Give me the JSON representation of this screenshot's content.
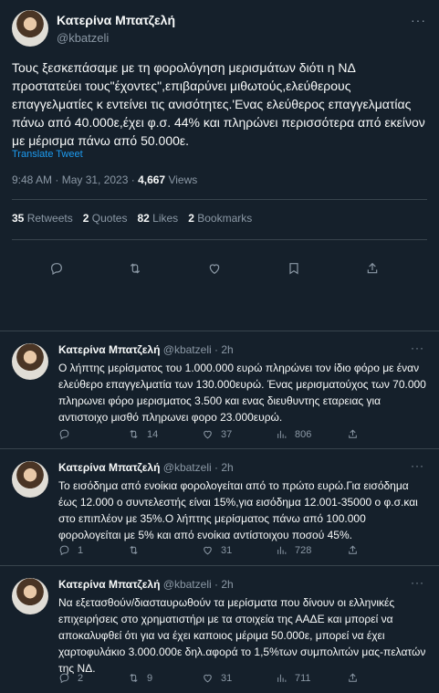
{
  "main_tweet": {
    "author_name": "Κατερίνα Μπατζελή",
    "author_handle": "@kbatzeli",
    "text": "Τους ξεσκεπάσαμε με τη φορολόγηση μερισμάτων διότι  η ΝΔ προστατεύει τους\"έχοντες\",επιβαρύνει μιθωτούς,ελεύθερους επαγγελματίες κ εντείνει τις ανισότητες.'Ενας ελεύθερος επαγγελματίας πάνω από 40.000ε,έχει φ.σ. 44% και πληρώνει περισσότερα από εκείνον με μέρισμα πάνω από 50.000ε.",
    "translate_label": "Translate Tweet",
    "timestamp": "9:48 AM · May 31, 2023 · ",
    "views_count": "4,667",
    "views_label": " Views",
    "stats": {
      "retweets_count": "35",
      "retweets_label": "Retweets",
      "quotes_count": "2",
      "quotes_label": "Quotes",
      "likes_count": "82",
      "likes_label": "Likes",
      "bookmarks_count": "2",
      "bookmarks_label": "Bookmarks"
    }
  },
  "replies": [
    {
      "author_name": "Κατερίνα Μπατζελή",
      "author_handle": "@kbatzeli",
      "time": "· 2h",
      "text": "Ο λήπτης μερίσματος του 1.000.000 ευρώ πληρώνει τον ίδιο φόρο με έναν ελεύθερο επαγγελματία των 130.000ευρώ. Ένας μερισματούχος των 70.000 πληρωνει φόρο μερισματος 3.500 και ενας διευθυντης εταρειας για αντιστοιχο μισθό πληρωνει φορο 23.000ευρώ.",
      "reply_count": "",
      "retweet_count": "14",
      "like_count": "37",
      "view_count": "806"
    },
    {
      "author_name": "Κατερίνα Μπατζελή",
      "author_handle": "@kbatzeli",
      "time": "· 2h",
      "text": "Το εισόδημα από ενοίκια φορολογείται από το πρώτο ευρώ.Για εισόδημα έως 12.000 ο συντελεστής είναι 15%,για εισόδημα 12.001-35000 ο φ.σ.και στο επιπλέον με  35%.Ο λήπτης μερίσματος πάνω από 100.000 φορολογείται με 5% και από ενοίκια αντίστοιχου ποσού 45%.",
      "reply_count": "1",
      "retweet_count": "",
      "like_count": "31",
      "view_count": "728"
    },
    {
      "author_name": "Κατερίνα Μπατζελή",
      "author_handle": "@kbatzeli",
      "time": "· 2h",
      "text": "Να εξετασθούν/διασταυρωθούν τα μερίσματα που δίνουν οι ελληνικές επιχειρήσεις στο χρηματιστήρι με τα στοιχεία της ΑΑΔΕ και μπορεί να αποκαλυφθεί ότι για  να έχει καποιος μέριμα 50.000ε, μπορεί να έχει χαρτοφυλάκιο 3.000.000ε δηλ.αφορά το 1,5%των συμπολιτών μας-πελατών της ΝΔ.",
      "reply_count": "2",
      "retweet_count": "9",
      "like_count": "31",
      "view_count": "711"
    }
  ],
  "icons": {
    "more": "more-icon",
    "reply": "reply-icon",
    "retweet": "retweet-icon",
    "like": "heart-icon",
    "views": "views-icon",
    "bookmark": "bookmark-icon",
    "share": "share-icon"
  },
  "colors": {
    "background": "#15202b",
    "text": "#f7f9f9",
    "muted": "#8b98a5",
    "link": "#1d9bf0",
    "border": "#38444d"
  },
  "more_symbol": "···"
}
